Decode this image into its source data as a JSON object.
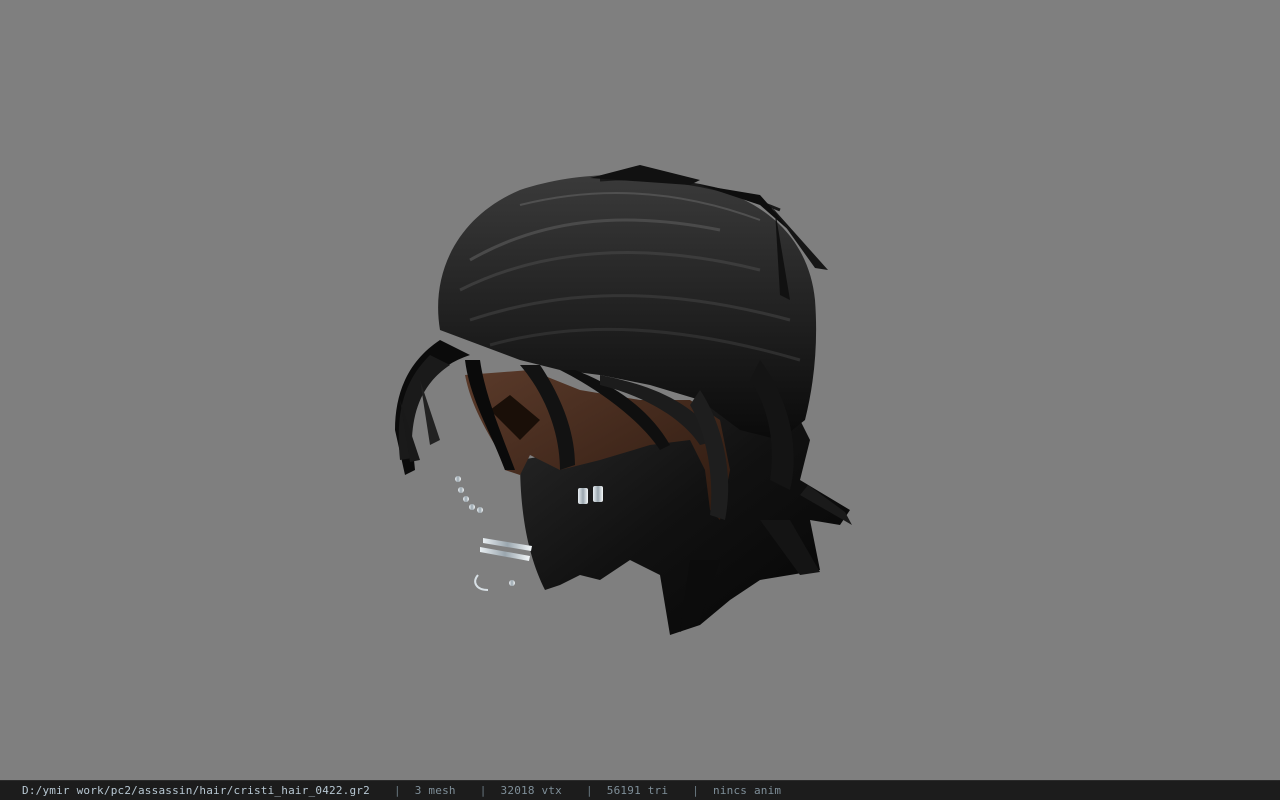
{
  "viewport": {
    "background_color": "#7f7f7f",
    "model_description_icon": "hair-mesh-model-icon"
  },
  "status_bar": {
    "file_path": "D:/ymir work/pc2/assassin/hair/cristi_hair_0422.gr2",
    "separator": "|",
    "mesh_count": "3 mesh",
    "vertex_count": "32018 vtx",
    "triangle_count": "56191 tri",
    "anim_status": "nincs anim"
  }
}
